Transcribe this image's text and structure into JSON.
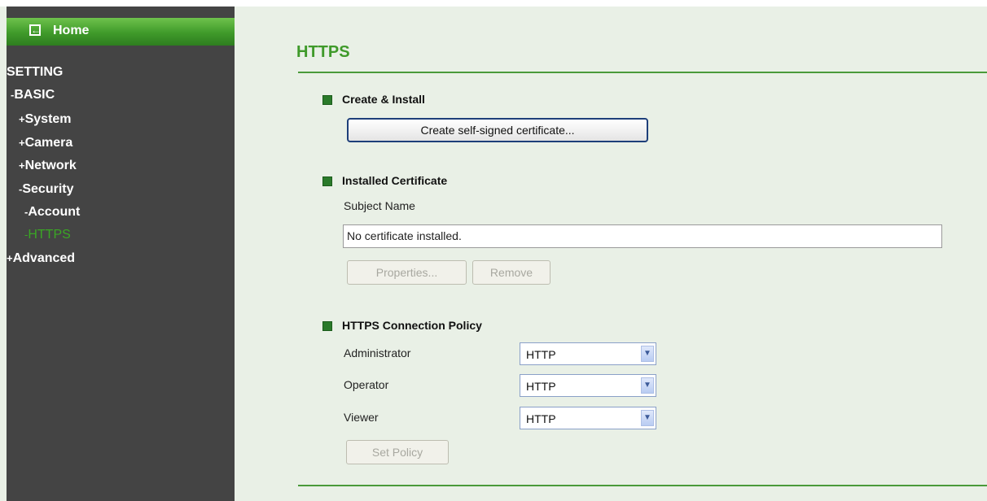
{
  "sidebar": {
    "home_label": "Home",
    "setting_label": "SETTING",
    "items": [
      {
        "mark": "-",
        "label": "BASIC"
      },
      {
        "mark": "+",
        "label": "System"
      },
      {
        "mark": "+",
        "label": "Camera"
      },
      {
        "mark": "+",
        "label": "Network"
      },
      {
        "mark": "-",
        "label": "Security"
      },
      {
        "mark": "-",
        "label": "Account"
      },
      {
        "mark": "-",
        "label": "HTTPS"
      },
      {
        "mark": "+",
        "label": "Advanced"
      }
    ]
  },
  "page": {
    "title": "HTTPS"
  },
  "create_install": {
    "header": "Create & Install",
    "button_label": "Create self-signed certificate..."
  },
  "installed_certificate": {
    "header": "Installed Certificate",
    "subject_label": "Subject Name",
    "subject_value": "No certificate installed.",
    "properties_label": "Properties...",
    "remove_label": "Remove"
  },
  "policy": {
    "header": "HTTPS Connection Policy",
    "rows": [
      {
        "label": "Administrator",
        "value": "HTTP"
      },
      {
        "label": "Operator",
        "value": "HTTP"
      },
      {
        "label": "Viewer",
        "value": "HTTP"
      }
    ],
    "set_policy_label": "Set Policy"
  },
  "colors": {
    "accent_green": "#3f9a2a",
    "sidebar_bg": "#444444",
    "content_bg": "#e9f0e6",
    "active_nav": "#3aa624"
  },
  "icons": {
    "home": "back-arrow-icon",
    "bullet": "green-square-bullet",
    "dropdown": "chevron-down-icon"
  }
}
